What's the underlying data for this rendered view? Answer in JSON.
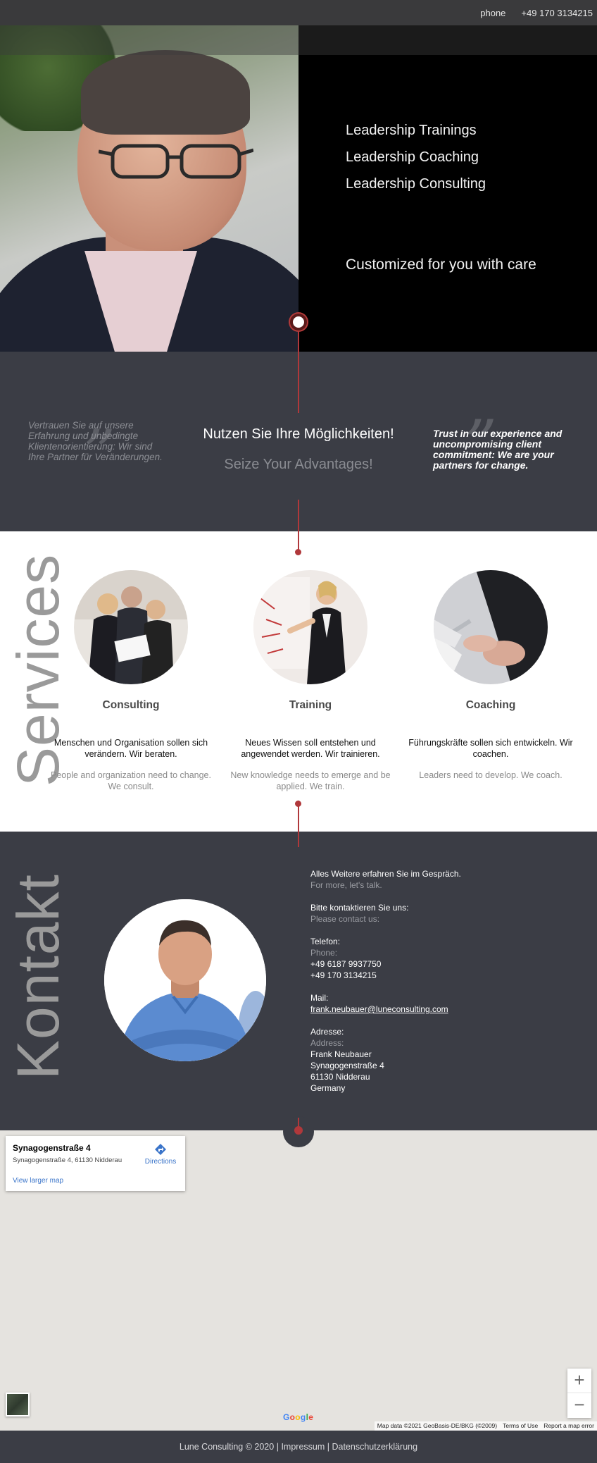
{
  "topbar": {
    "phone_label": "phone",
    "phone_number": "+49 170 3134215"
  },
  "hero": {
    "lines": [
      "Leadership Trainings",
      "Leadership Coaching",
      "Leadership Consulting"
    ],
    "tagline": "Customized for you with care"
  },
  "claim": {
    "left_de": "Vertrauen Sie auf unsere Erfahrung und unbedingte Klientenorientierung: Wir sind Ihre Partner für Veränderungen.",
    "title_de": "Nutzen Sie Ihre Möglichkeiten!",
    "subtitle_en": "Seize Your Advantages!",
    "right_en": "Trust in our experience and uncompromising client commitment:  We are your partners for change."
  },
  "services": {
    "section_title": "Services",
    "items": [
      {
        "title": "Consulting",
        "de": "Menschen und Organisation sollen sich verändern. Wir beraten.",
        "en": "People and organization need to change. We consult."
      },
      {
        "title": "Training",
        "de": "Neues Wissen soll entstehen und angewendet werden. Wir trainieren.",
        "en": "New knowledge needs to emerge and be applied. We train."
      },
      {
        "title": "Coaching",
        "de": "Führungskräfte sollen sich entwickeln. Wir coachen.",
        "en": "Leaders need to develop. We coach."
      }
    ]
  },
  "contact": {
    "section_title": "Kontakt",
    "intro_de": "Alles Weitere erfahren Sie im Gespräch.",
    "intro_en": "For more, let's talk.",
    "please_de": "Bitte kontaktieren Sie uns:",
    "please_en": "Please contact us:",
    "phone_de": "Telefon:",
    "phone_en": "Phone:",
    "phone_1": "+49 6187 9937750",
    "phone_2": "+49 170 3134215",
    "mail_label": "Mail:",
    "mail": "frank.neubauer@luneconsulting.com",
    "address_de": "Adresse:",
    "address_en": "Address:",
    "address_lines": [
      "Frank Neubauer",
      "Synagogenstraße 4",
      "61130 Nidderau",
      "Germany"
    ]
  },
  "map": {
    "place_title": "Synagogenstraße 4",
    "place_address": "Synagogenstraße 4, 61130 Nidderau",
    "directions": "Directions",
    "larger_map": "View larger map",
    "attribution": "Map data ©2021 GeoBasis-DE/BKG (©2009)",
    "terms": "Terms of Use",
    "report": "Report a map error",
    "zoom_in": "+",
    "zoom_out": "−",
    "google_letters": [
      "G",
      "o",
      "o",
      "g",
      "l",
      "e"
    ]
  },
  "footer": {
    "copyright": "Lune Consulting © 2020",
    "sep": "|",
    "impressum": "Impressum",
    "privacy": "Datenschutzerklärung"
  },
  "colors": {
    "accent": "#b0383b",
    "dark": "#3b3d45",
    "hero_bg": "#000000"
  }
}
